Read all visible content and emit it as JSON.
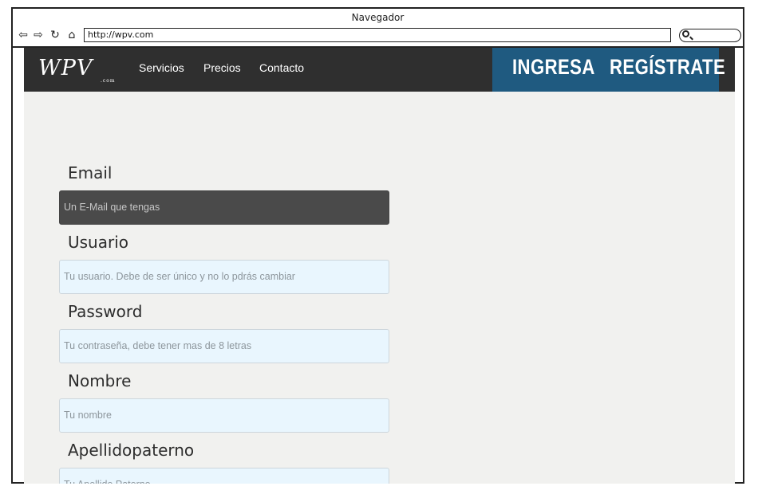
{
  "window": {
    "title": "Navegador"
  },
  "toolbar": {
    "back_icon": "arrow-left-icon",
    "forward_icon": "arrow-right-icon",
    "reload_icon": "reload-icon",
    "home_icon": "home-icon",
    "url": "http://wpv.com",
    "search_icon": "search-icon"
  },
  "site": {
    "logo": "WPV",
    "logo_suffix": ".com",
    "nav": [
      "Servicios",
      "Precios",
      "Contacto"
    ],
    "login_label": "INGRESA",
    "register_label": "REGÍSTRATE",
    "accent_color": "#1f5a80",
    "header_color": "#2f2f2f"
  },
  "form": {
    "fields": [
      {
        "label": "Email",
        "placeholder": "Un E-Mail que tengas",
        "focused": true
      },
      {
        "label": "Usuario",
        "placeholder": "Tu usuario. Debe de ser único y no lo pdrás cambiar",
        "focused": false
      },
      {
        "label": "Password",
        "placeholder": "Tu contraseña, debe tener mas de 8 letras",
        "focused": false
      },
      {
        "label": "Nombre",
        "placeholder": "Tu nombre",
        "focused": false
      },
      {
        "label": "Apellidopaterno",
        "placeholder": "Tu Apellido Paterno",
        "focused": false
      }
    ]
  }
}
